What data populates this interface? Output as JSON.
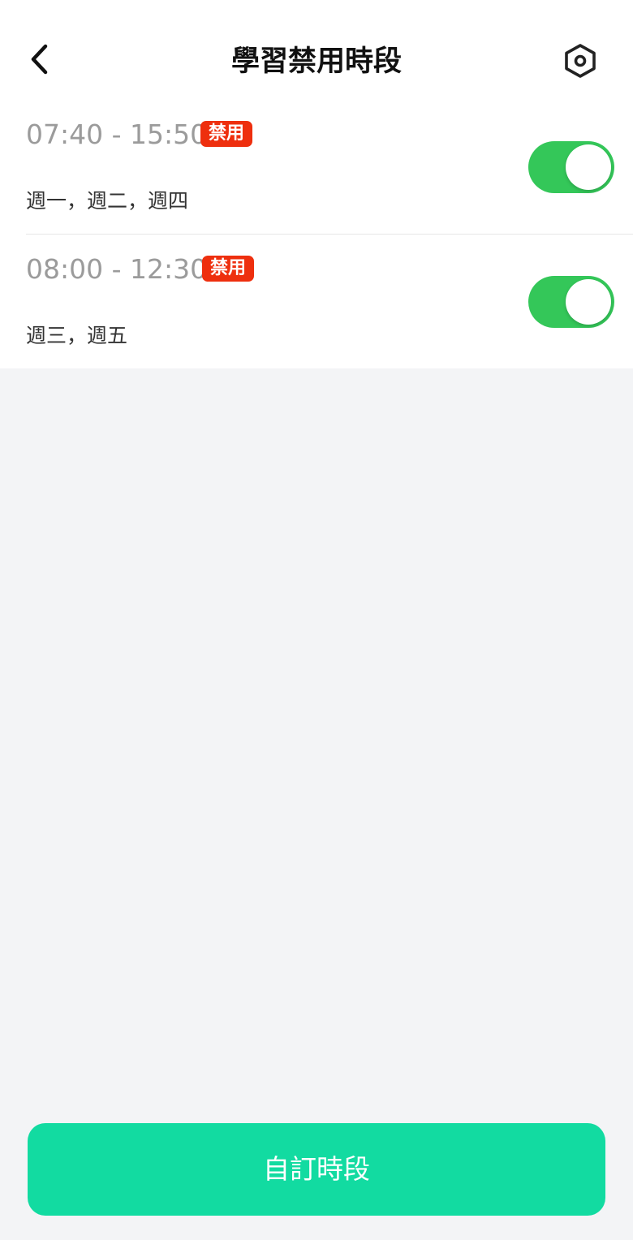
{
  "header": {
    "title": "學習禁用時段",
    "back_icon": "chevron-left-icon",
    "settings_icon": "hexagon-gear-icon"
  },
  "schedules": [
    {
      "time_range": "07:40 - 15:50",
      "badge": "禁用",
      "days": "週一，週二，週四",
      "enabled": true
    },
    {
      "time_range": "08:00 - 12:30",
      "badge": "禁用",
      "days": "週三，週五",
      "enabled": true
    }
  ],
  "footer": {
    "custom_button_label": "自訂時段"
  },
  "colors": {
    "badge_red": "#ee2f0e",
    "toggle_green": "#34c759",
    "button_green": "#12dba1",
    "background_gray": "#f3f4f6"
  }
}
